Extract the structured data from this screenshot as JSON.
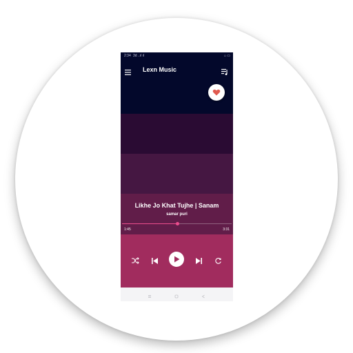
{
  "status_bar": {
    "time": "2:34",
    "indicators": "3d ..ıl ıl",
    "right": "⌂ ▭"
  },
  "toolbar": {
    "title": "Lexn Music",
    "menu_icon": "hamburger-menu-icon",
    "queue_icon": "playlist-queue-icon"
  },
  "favorite": {
    "icon": "heart-icon",
    "color": "#e05a4f"
  },
  "now_playing": {
    "title": "Likhe Jo Khat Tujhe | Sanam",
    "artist": "samar puri",
    "elapsed": "1:45",
    "duration": "3:31",
    "progress": 0.5
  },
  "controls": [
    "shuffle-icon",
    "skip-previous-icon",
    "play-icon",
    "skip-next-icon",
    "repeat-icon"
  ],
  "colors": {
    "header_bg": "#03082b",
    "band1": "#2a0b33",
    "band2": "#451742",
    "band3": "#611d49",
    "controls_bg": "#a12c5e",
    "accent": "#ec4d8e"
  },
  "nav_bar": [
    "recents-icon",
    "home-icon",
    "back-icon"
  ]
}
